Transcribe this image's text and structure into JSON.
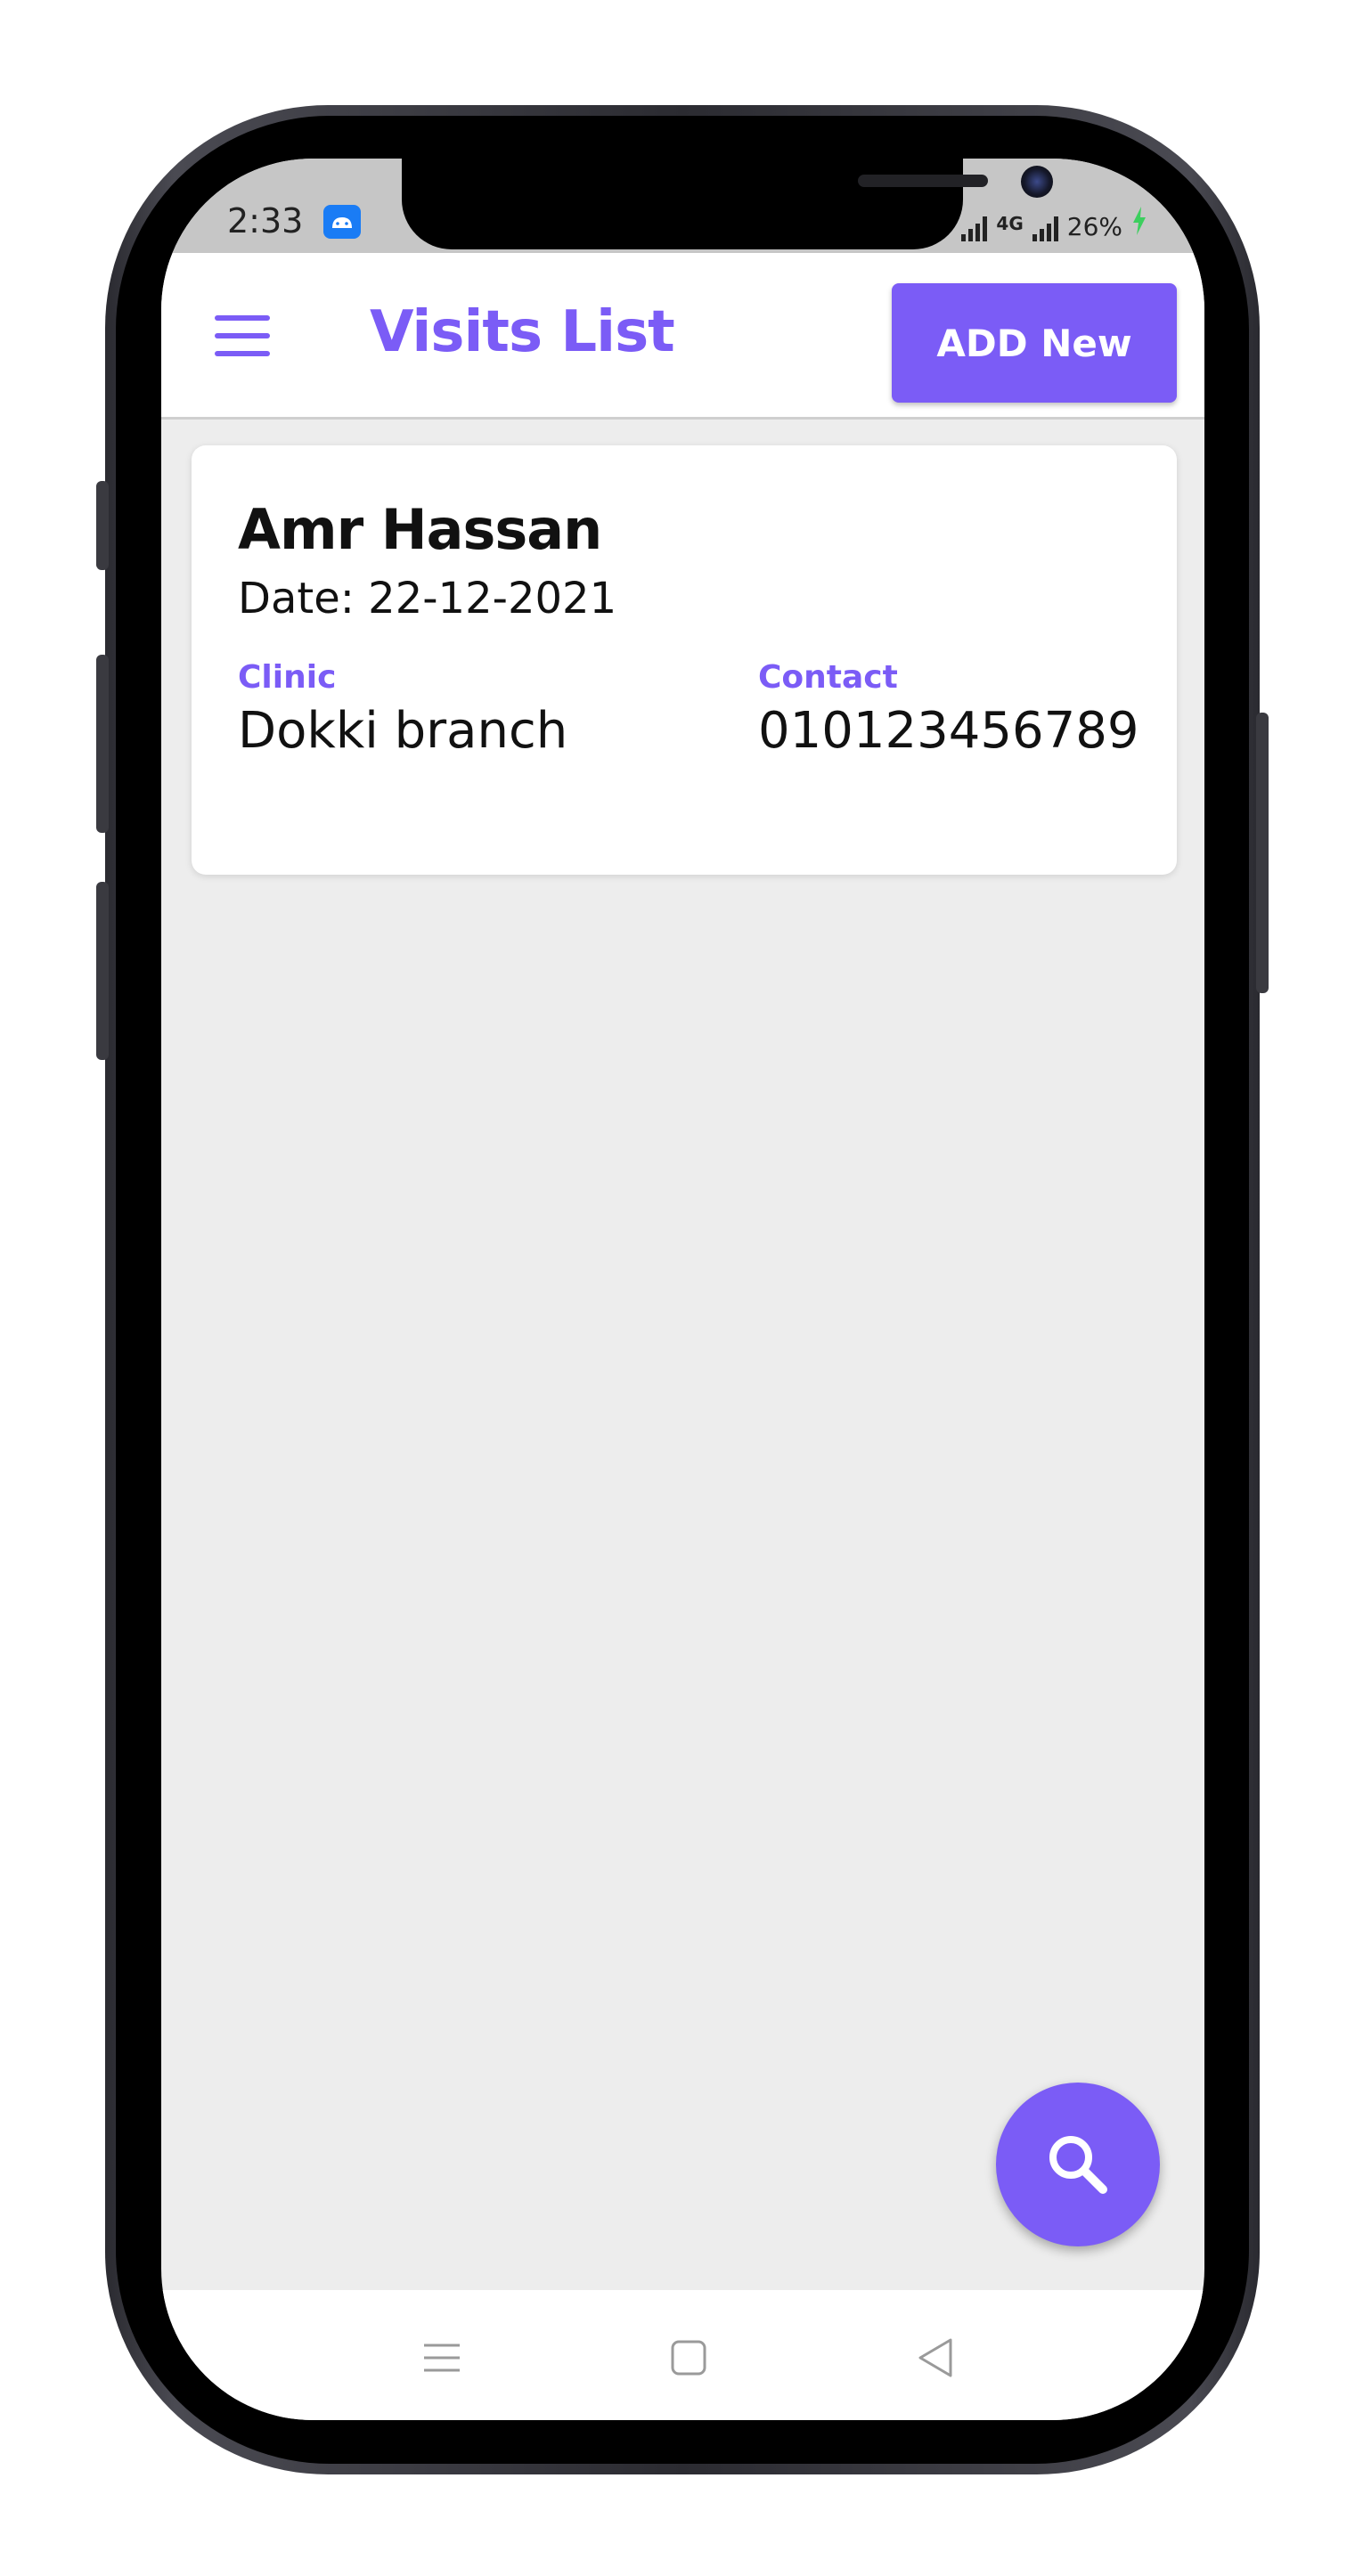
{
  "status_bar": {
    "time": "2:33",
    "network": "4G",
    "battery": "26%"
  },
  "header": {
    "title": "Visits List",
    "add_button_label": "ADD New"
  },
  "visits": [
    {
      "name": "Amr Hassan",
      "date": "Date: 22-12-2021",
      "clinic_label": "Clinic",
      "clinic_value": "Dokki branch",
      "contact_label": "Contact",
      "contact_value": "010123456789"
    }
  ],
  "colors": {
    "accent": "#7b5cf6",
    "background": "#ededed",
    "card": "#ffffff",
    "status_bar": "#c6c6c6"
  },
  "icons": {
    "menu": "hamburger-menu-icon",
    "fab": "search-icon",
    "nav": [
      "recent-apps-icon",
      "home-icon",
      "back-icon"
    ]
  }
}
